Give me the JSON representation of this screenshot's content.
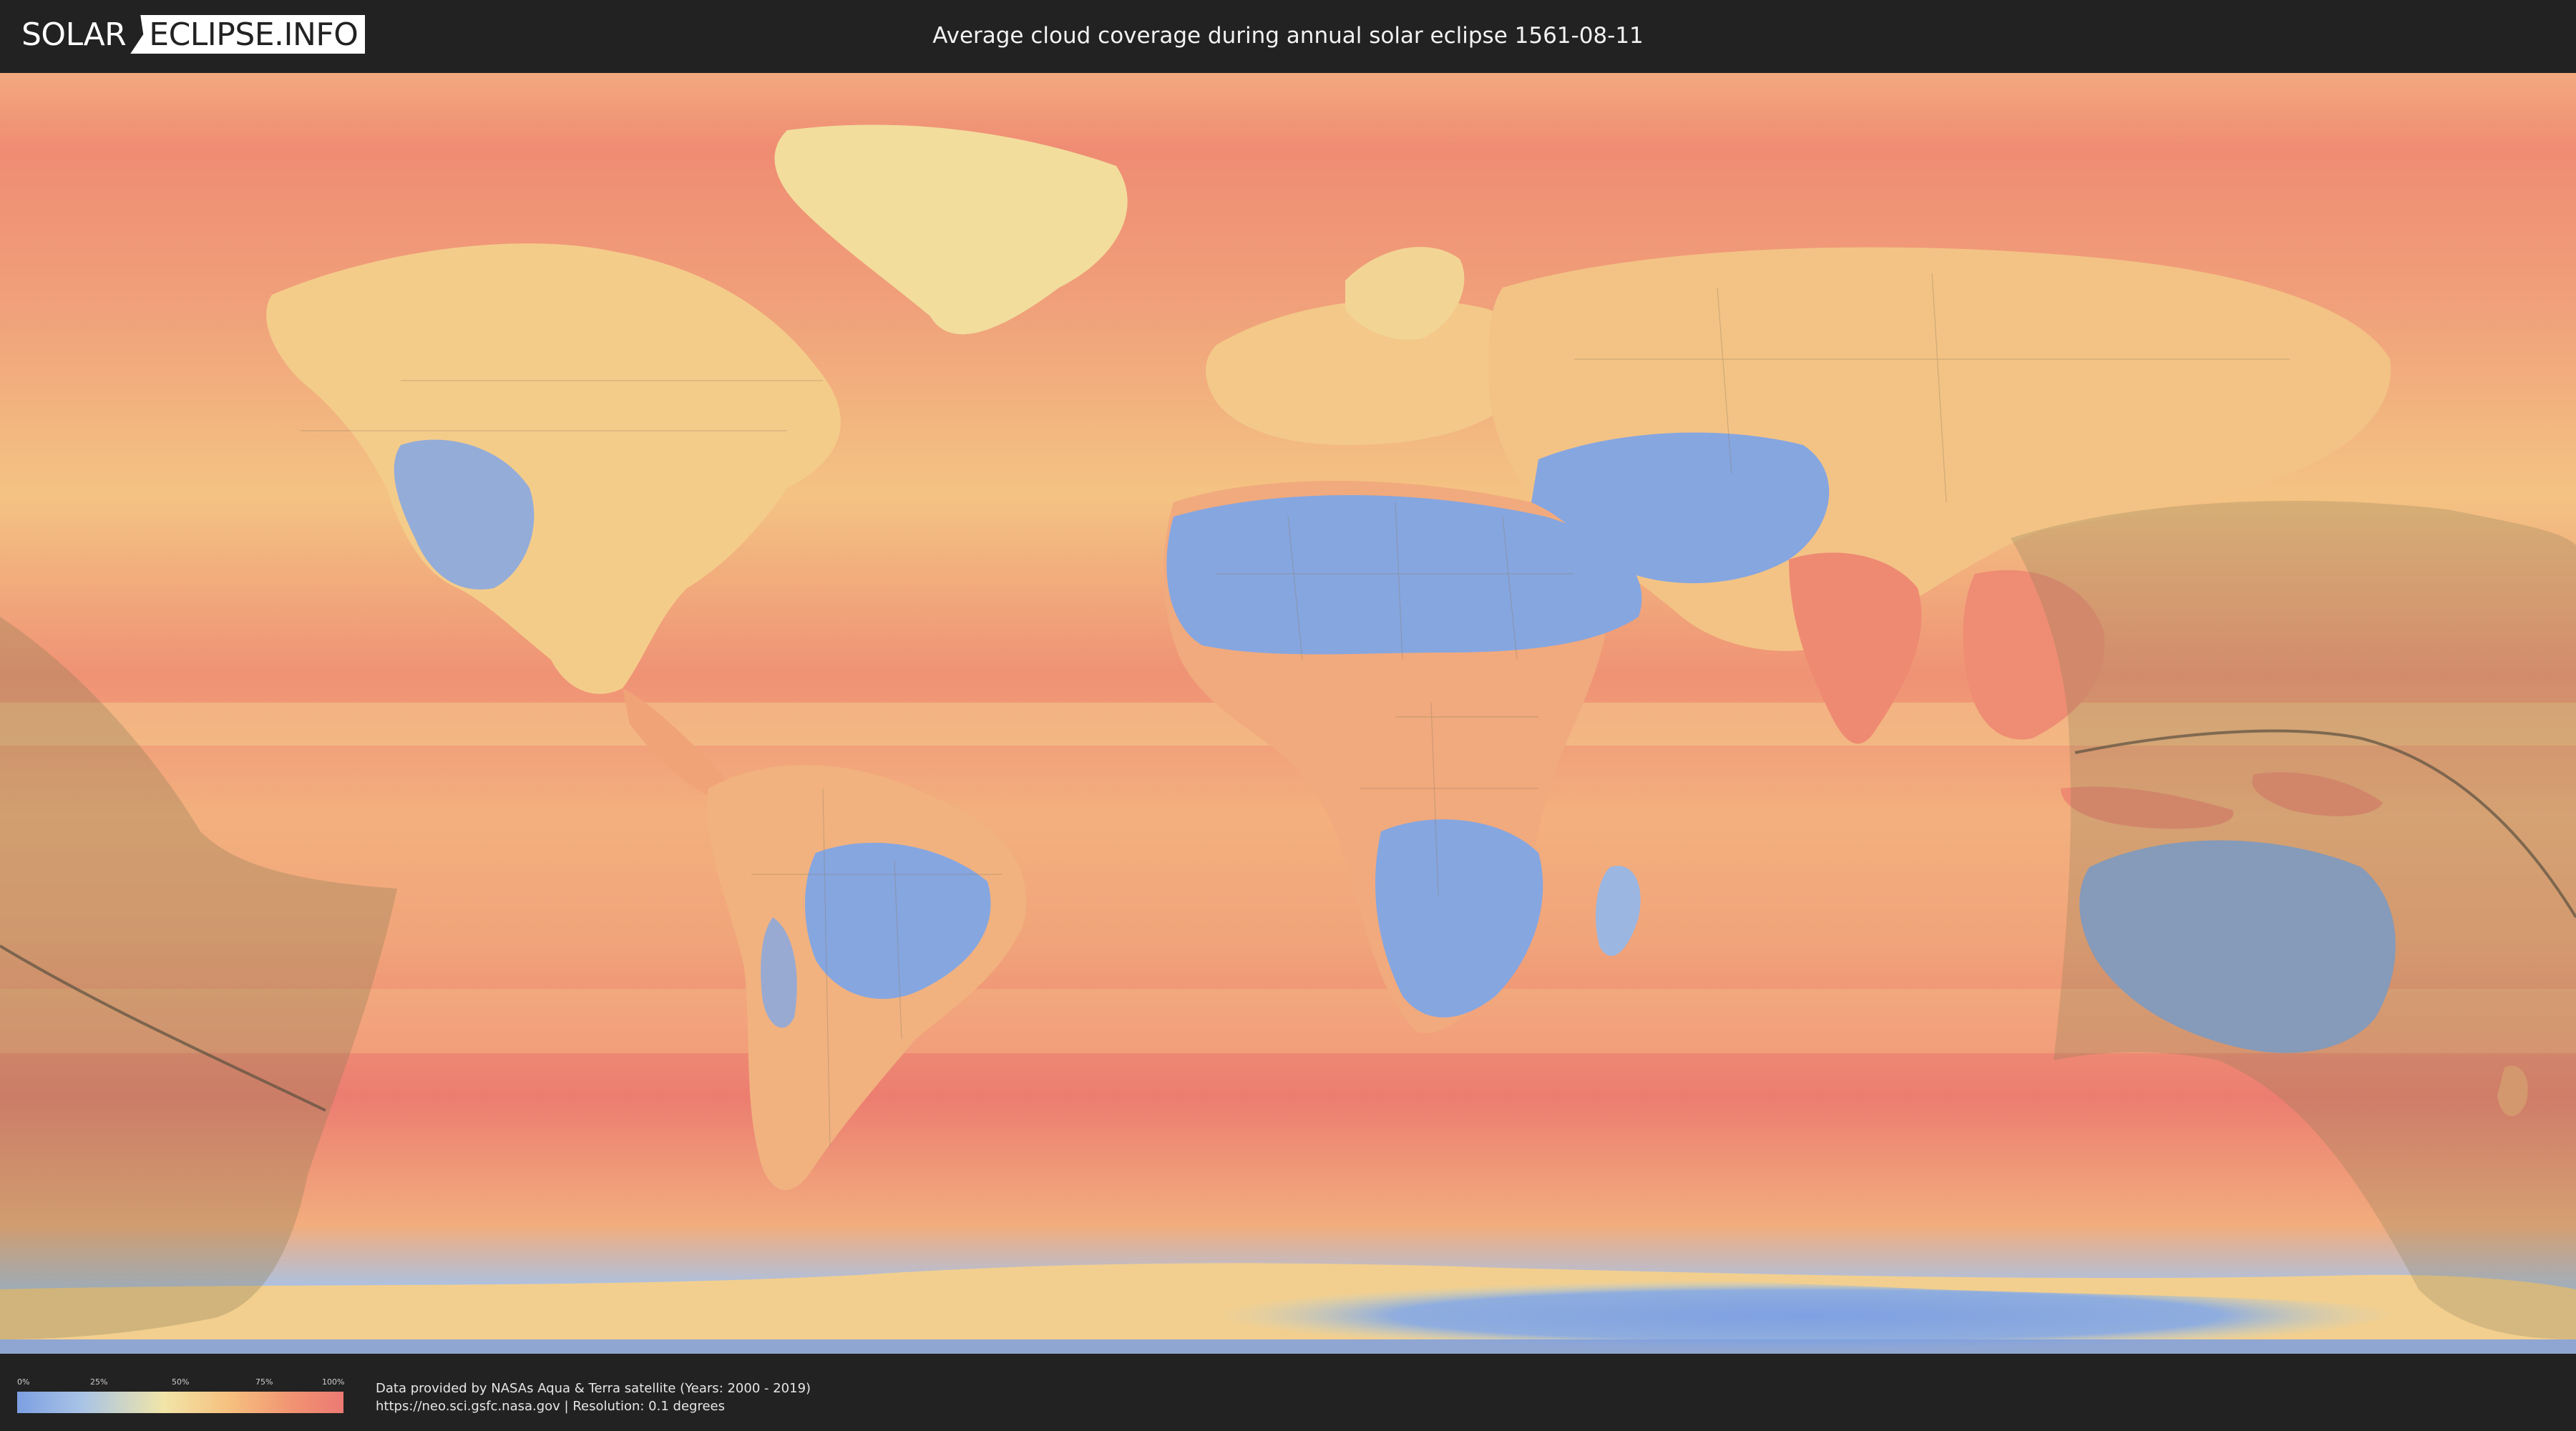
{
  "header": {
    "logo_left": "SOLAR",
    "logo_right": "ECLIPSE.INFO",
    "title": "Average cloud coverage during annual solar eclipse 1561-08-11"
  },
  "legend": {
    "ticks": [
      "0%",
      "25%",
      "50%",
      "75%",
      "100%"
    ],
    "colors": [
      "#7d9fe2",
      "#f1e5a8",
      "#ec7a73"
    ]
  },
  "credits": {
    "line1": "Data provided by NASAs Aqua & Terra satellite (Years: 2000 - 2019)",
    "line2": "https://neo.sci.gsfc.nasa.gov | Resolution: 0.1 degrees"
  },
  "map": {
    "type": "world cloud coverage",
    "colors": {
      "ocean_warm": "#ef8b73",
      "ocean_mid": "#f3b27d",
      "land_mid": "#f2d18f",
      "dry_blue": "#86a6e0",
      "eclipse_shadow": "#8a7d55"
    }
  }
}
